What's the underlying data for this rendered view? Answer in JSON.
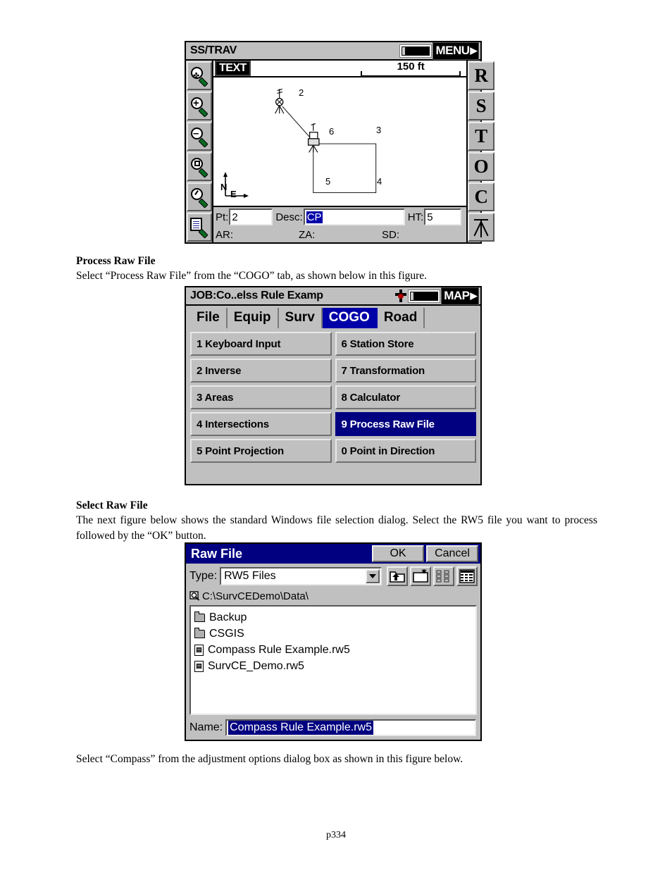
{
  "document": {
    "footer": "p334",
    "sections": [
      {
        "heading": "Process Raw File",
        "body": "Select “Process Raw File” from the “COGO” tab, as shown below in this figure."
      },
      {
        "heading": "Select Raw File",
        "body": "The next figure below shows the standard Windows file selection dialog. Select the RW5 file you want to process followed by the “OK” button."
      }
    ],
    "closing_paragraph": "Select “Compass” from the adjustment options dialog box as shown in this figure below."
  },
  "figure_map": {
    "title": "SS/TRAV",
    "menu_button": "MENU",
    "menu_arrow": "▶",
    "text_button": "TEXT",
    "scale_label": "150 ft",
    "north_label": "N",
    "east_label": "E",
    "left_tools": [
      {
        "name": "pan-zoom-tool",
        "glyph": "pan"
      },
      {
        "name": "zoom-in-tool",
        "glyph": "plus"
      },
      {
        "name": "zoom-out-tool",
        "glyph": "minus"
      },
      {
        "name": "zoom-window-tool",
        "glyph": "square"
      },
      {
        "name": "zoom-previous-tool",
        "glyph": "rotate"
      },
      {
        "name": "list-points-tool",
        "glyph": "document"
      }
    ],
    "right_tools": [
      {
        "name": "r-button",
        "label": "R"
      },
      {
        "name": "s-button",
        "label": "S"
      },
      {
        "name": "t-button",
        "label": "T"
      },
      {
        "name": "o-button",
        "label": "O"
      },
      {
        "name": "c-button",
        "label": "C"
      },
      {
        "name": "instrument-setup-button",
        "label": "tripod"
      }
    ],
    "point_labels": [
      "2",
      "6",
      "3",
      "5",
      "4"
    ],
    "fields": [
      {
        "label": "Pt:",
        "value": "2",
        "selected": false
      },
      {
        "label": "Desc:",
        "value": "CP",
        "selected": true
      },
      {
        "label": "HT:",
        "value": "5",
        "selected": false
      }
    ],
    "status": [
      "AR:",
      "ZA:",
      "SD:"
    ]
  },
  "figure_cogo": {
    "title": "JOB:Co..elss Rule Examp",
    "map_button": "MAP",
    "map_arrow": "▶",
    "tabs": [
      {
        "label": "File",
        "active": false
      },
      {
        "label": "Equip",
        "active": false
      },
      {
        "label": "Surv",
        "active": false
      },
      {
        "label": "COGO",
        "active": true
      },
      {
        "label": "Road",
        "active": false
      }
    ],
    "menu_items": [
      {
        "label": "1 Keyboard Input",
        "active": false
      },
      {
        "label": "6 Station Store",
        "active": false
      },
      {
        "label": "2 Inverse",
        "active": false
      },
      {
        "label": "7 Transformation",
        "active": false
      },
      {
        "label": "3 Areas",
        "active": false
      },
      {
        "label": "8 Calculator",
        "active": false
      },
      {
        "label": "4 Intersections",
        "active": false
      },
      {
        "label": "9 Process Raw File",
        "active": true
      },
      {
        "label": "5 Point Projection",
        "active": false
      },
      {
        "label": "0 Point in Direction",
        "active": false
      }
    ]
  },
  "figure_dialog": {
    "title": "Raw File",
    "ok_label": "OK",
    "cancel_label": "Cancel",
    "type_label": "Type:",
    "type_value": "RW5 Files",
    "path": "C:\\SurvCEDemo\\Data\\",
    "toolbar_icons": [
      "up-one-level-icon",
      "new-folder-icon",
      "list-view-icon",
      "details-view-icon"
    ],
    "files": [
      {
        "name": "Backup",
        "type": "folder"
      },
      {
        "name": "CSGIS",
        "type": "folder"
      },
      {
        "name": "Compass Rule Example.rw5",
        "type": "file"
      },
      {
        "name": "SurvCE_Demo.rw5",
        "type": "file"
      }
    ],
    "name_label": "Name:",
    "name_value": "Compass Rule Example.rw5"
  },
  "colors": {
    "selection_blue": "#000080",
    "tab_blue": "#0000a8",
    "chrome_gray": "#c0c0c0"
  }
}
